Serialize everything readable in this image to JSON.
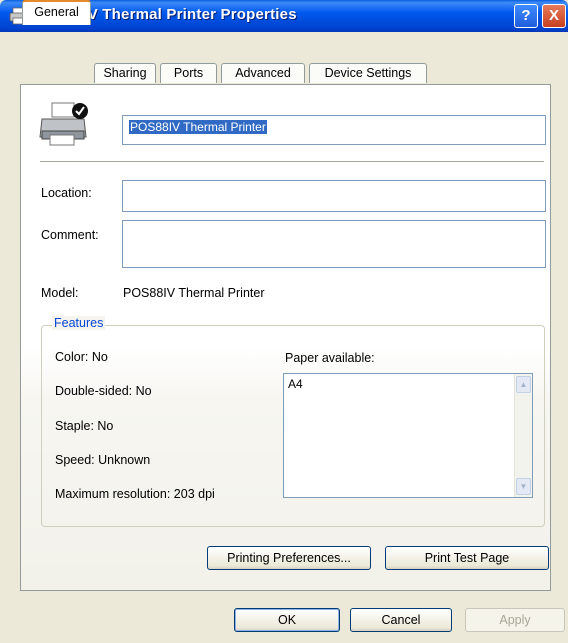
{
  "window": {
    "title": "POS88IV Thermal Printer Properties",
    "help": "?",
    "close": "X"
  },
  "tabs": [
    "General",
    "Sharing",
    "Ports",
    "Advanced",
    "Device Settings"
  ],
  "general": {
    "printer_name": "POS88IV Thermal Printer",
    "location_label": "Location:",
    "location_value": "",
    "comment_label": "Comment:",
    "comment_value": "",
    "model_label": "Model:",
    "model_value": "POS88IV Thermal Printer"
  },
  "features": {
    "legend": "Features",
    "color": "Color: No",
    "double_sided": "Double-sided: No",
    "staple": "Staple: No",
    "speed": "Speed: Unknown",
    "max_resolution": "Maximum resolution: 203 dpi",
    "paper_label": "Paper available:",
    "paper_items": [
      "A4"
    ]
  },
  "buttons": {
    "printing_preferences": "Printing Preferences...",
    "print_test_page": "Print Test Page",
    "ok": "OK",
    "cancel": "Cancel",
    "apply": "Apply"
  },
  "colors": {
    "titlebar": "#0058ee",
    "dialog_bg": "#ece9d8",
    "tab_highlight": "#e68b2c",
    "legend": "#0046d5"
  }
}
